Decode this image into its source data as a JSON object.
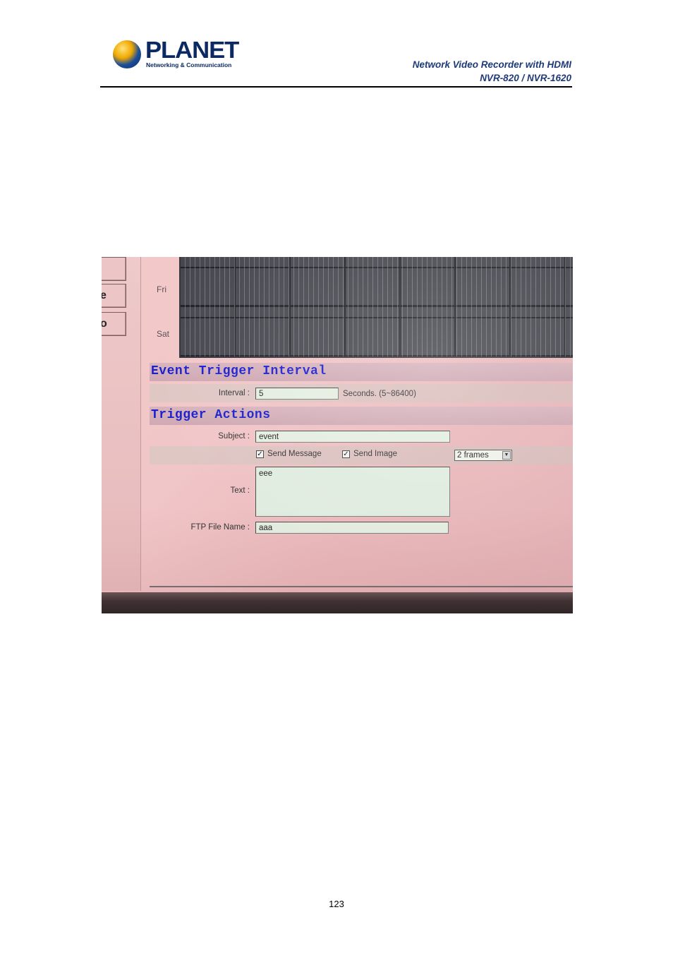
{
  "header": {
    "logo": {
      "brand": "PLANET",
      "tagline": "Networking & Communication"
    },
    "doc_title_line1": "Network Video Recorder with HDMI",
    "doc_title_line2": "NVR-820 / NVR-1620"
  },
  "screen": {
    "side_buttons": [
      "",
      "e",
      "o"
    ],
    "schedule_days": [
      "Fri",
      "Sat"
    ],
    "event_trigger_interval": {
      "title": "Event Trigger Interval",
      "interval_label": "Interval :",
      "interval_value": "5",
      "interval_unit": "Seconds. (5~86400)"
    },
    "trigger_actions": {
      "title": "Trigger Actions",
      "subject_label": "Subject :",
      "subject_value": "event",
      "send_message_label": "Send Message",
      "send_message_checked": true,
      "send_image_label": "Send Image",
      "send_image_checked": true,
      "frames_value": "2 frames",
      "text_label": "Text :",
      "text_value": "eee",
      "ftp_label": "FTP File Name :",
      "ftp_value": "aaa"
    }
  },
  "footer": {
    "page_number": "123"
  }
}
